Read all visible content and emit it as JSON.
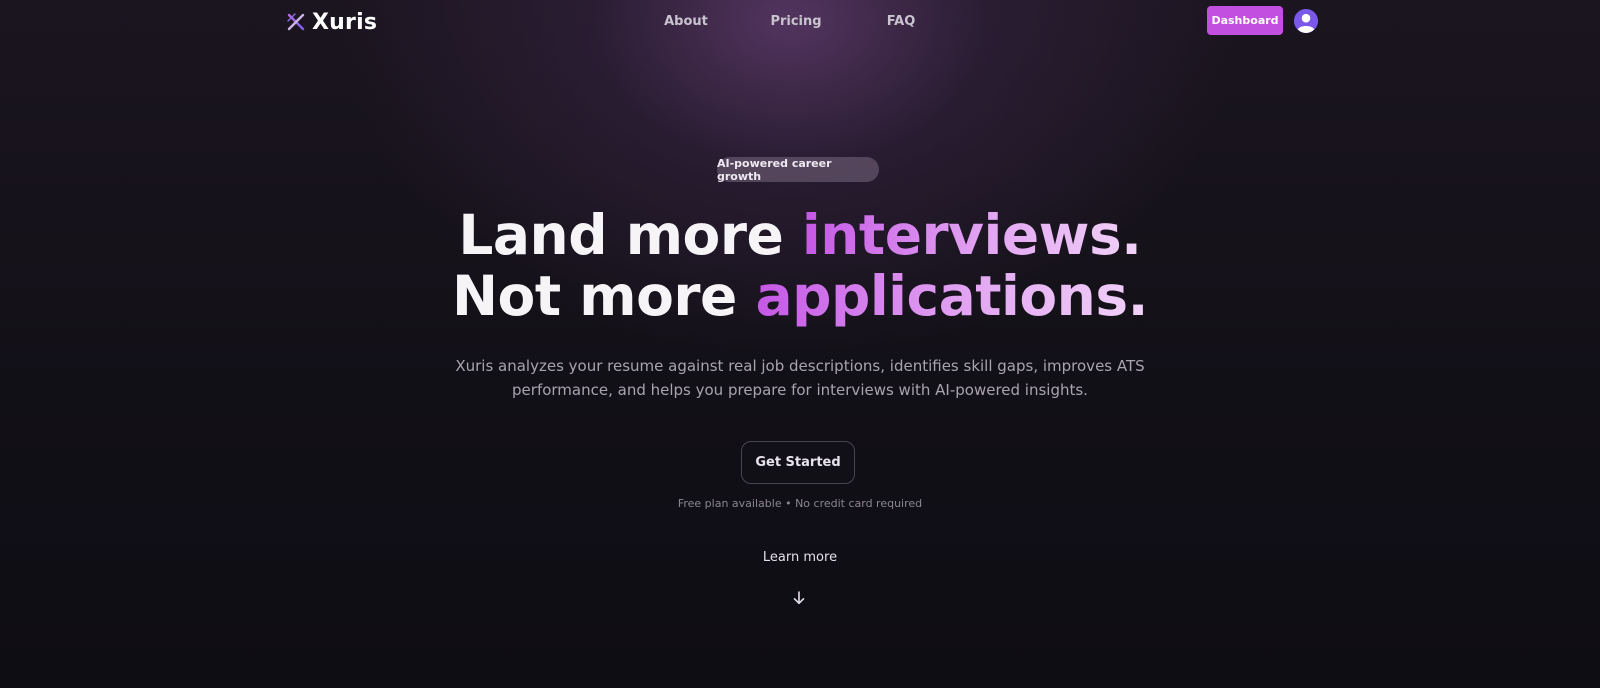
{
  "nav": {
    "brand": "Xuris",
    "brand_icon": "x-logo-icon",
    "links": [
      "About",
      "Pricing",
      "FAQ"
    ],
    "dashboard_label": "Dashboard",
    "avatar_icon": "user-icon"
  },
  "hero": {
    "badge": "AI-powered career growth",
    "headline_line1_plain": "Land more",
    "headline_line1_accent": "interviews.",
    "headline_line2_plain": "Not more",
    "headline_line2_accent": "applications.",
    "subtitle": "Xuris analyzes your resume against real job descriptions, identifies skill gaps, improves ATS performance, and helps you prepare for interviews with AI-powered insights.",
    "cta_label": "Get Started",
    "note": "Free plan available • No credit card required",
    "learn_more": "Learn more",
    "arrow_icon": "arrow-down-icon"
  },
  "colors": {
    "accent": "#c34fe0",
    "avatar": "#7a58e8",
    "background": "#0f0d14"
  }
}
